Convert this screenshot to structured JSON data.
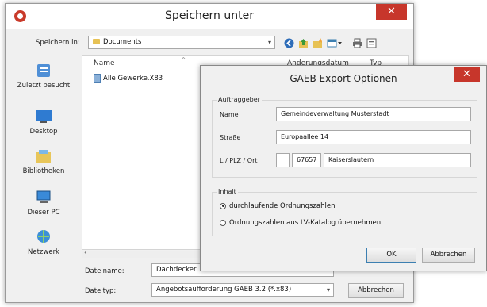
{
  "save_dialog": {
    "title": "Speichern unter",
    "save_in_label": "Speichern in:",
    "save_in_value": "Documents",
    "places": [
      "Zuletzt besucht",
      "Desktop",
      "Bibliotheken",
      "Dieser PC",
      "Netzwerk"
    ],
    "columns": {
      "name": "Name",
      "date": "Änderungsdatum",
      "type": "Typ"
    },
    "files": [
      "Alle Gewerke.X83"
    ],
    "filename_label": "Dateiname:",
    "filename_value": "Dachdecker",
    "filetype_label": "Dateityp:",
    "filetype_value": "Angebotsaufforderung GAEB 3.2 (*.x83)",
    "cancel_label": "Abbrechen",
    "close_glyph": "✕"
  },
  "gaeb_dialog": {
    "title": "GAEB Export Optionen",
    "group_client": "Auftraggeber",
    "name_label": "Name",
    "name_value": "Gemeindeverwaltung Musterstadt",
    "street_label": "Straße",
    "street_value": "Europaallee 14",
    "city_label": "L / PLZ / Ort",
    "country_value": "",
    "zip_value": "67657",
    "city_value": "Kaiserslautern",
    "group_content": "Inhalt",
    "radio_continuous": "durchlaufende Ordnungszahlen",
    "radio_catalog": "Ordnungszahlen aus LV-Katalog übernehmen",
    "ok_label": "OK",
    "cancel_label": "Abbrechen",
    "close_glyph": "✕"
  }
}
